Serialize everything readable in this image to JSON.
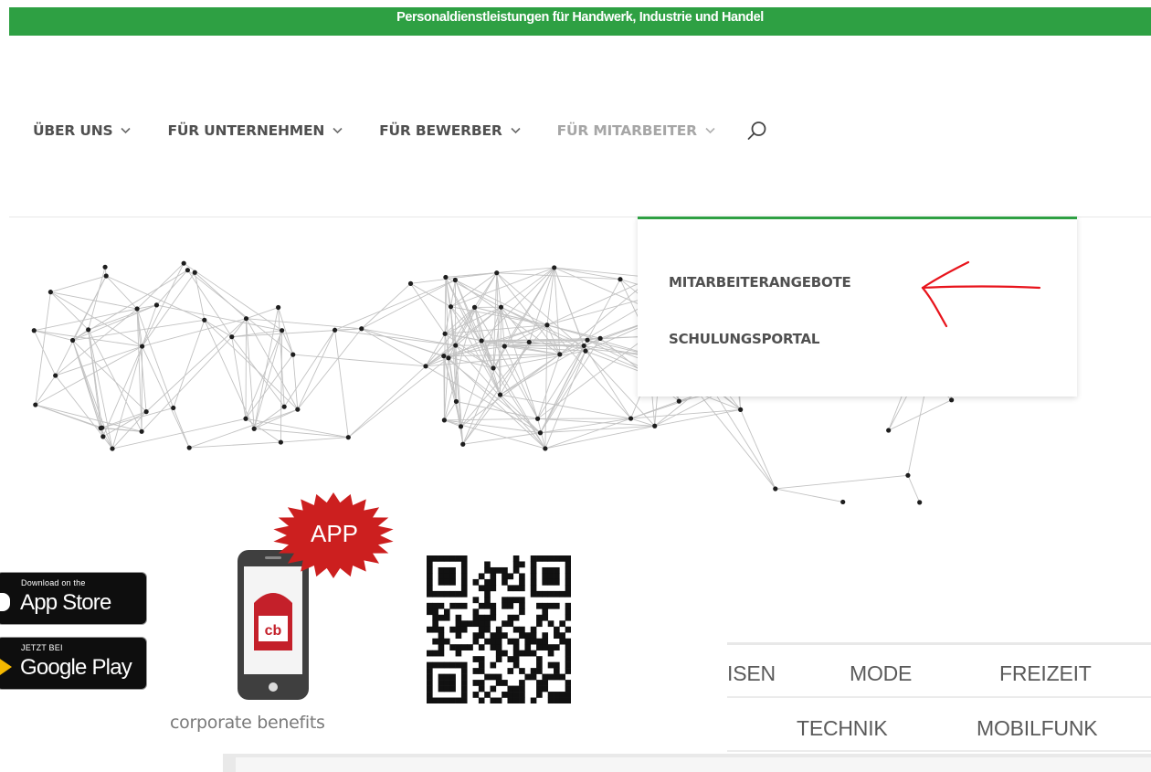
{
  "banner": {
    "text": "Personaldienstleistungen für Handwerk, Industrie und Handel"
  },
  "nav": {
    "items": [
      {
        "label": "ÜBER UNS"
      },
      {
        "label": "FÜR UNTERNEHMEN"
      },
      {
        "label": "FÜR BEWERBER"
      },
      {
        "label": "FÜR MITARBEITER"
      }
    ],
    "search_icon": "search-icon"
  },
  "dropdown": {
    "items": [
      {
        "label": "MITARBEITERANGEBOTE"
      },
      {
        "label": "SCHULUNGSPORTAL"
      }
    ],
    "annotation": "red-arrow"
  },
  "app_promo": {
    "appstore": {
      "small": "Download on the",
      "big": "App Store"
    },
    "googleplay": {
      "small": "JETZT BEI",
      "big": "Google Play"
    },
    "burst_label": "APP",
    "phone_logo": "cb",
    "caption": "corporate benefits"
  },
  "categories": {
    "row1": [
      "ISEN",
      "MODE",
      "FREIZEIT"
    ],
    "row2": [
      "TECHNIK",
      "MOBILFUNK"
    ]
  },
  "colors": {
    "brand_green": "#2ea043",
    "nav_text": "#505050",
    "nav_text_inactive": "#a6a6a6",
    "annotation_red": "#e8141c",
    "badge_red": "#cc1f1f"
  }
}
